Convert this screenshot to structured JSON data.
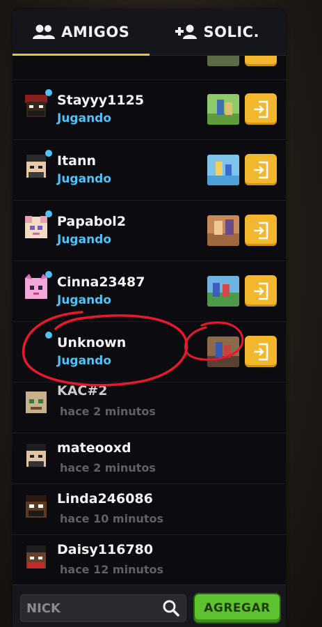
{
  "tabs": [
    {
      "label": "AMIGOS",
      "icon": "people-icon",
      "active": true
    },
    {
      "label": "SOLIC.",
      "icon": "add-friend-icon",
      "active": false
    }
  ],
  "friends": [
    {
      "name": "Stayyy1125",
      "status": "Jugando",
      "online": true
    },
    {
      "name": "Itann",
      "status": "Jugando",
      "online": true
    },
    {
      "name": "Papabol2",
      "status": "Jugando",
      "online": true
    },
    {
      "name": "Cinna23487",
      "status": "Jugando",
      "online": true
    },
    {
      "name": "Unknown",
      "status": "Jugando",
      "online": true
    },
    {
      "name": "KAC#2",
      "status": "hace 2 minutos",
      "online": false
    },
    {
      "name": "mateooxd",
      "status": "hace 2 minutos",
      "online": false
    },
    {
      "name": "Linda246086",
      "status": "hace 10 minutos",
      "online": false
    },
    {
      "name": "Daisy116780",
      "status": "hace 12 minutos",
      "online": false
    }
  ],
  "footer": {
    "search_placeholder": "NICK",
    "add_label": "AGREGAR"
  },
  "colors": {
    "accent": "#f0c030",
    "online_status": "#4fc3f7",
    "join_button": "#f2b72c",
    "add_button": "#5cc22f",
    "annotation": "#e8192c"
  }
}
